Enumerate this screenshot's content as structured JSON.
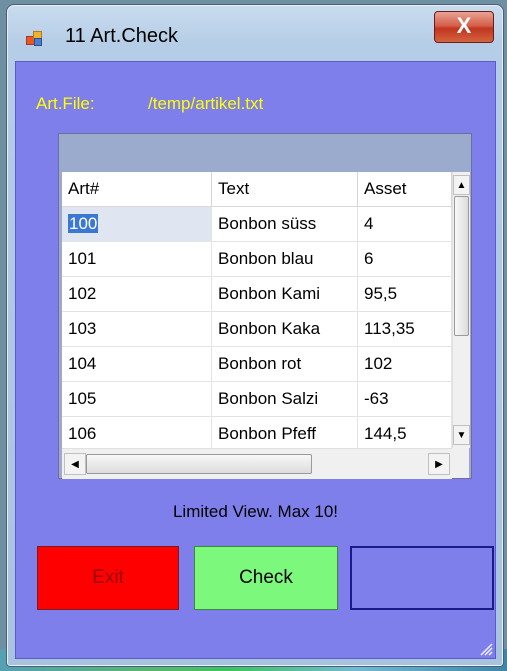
{
  "window": {
    "title": "11 Art.Check",
    "close_glyph": "X"
  },
  "artfile": {
    "label": "Art.File:",
    "path": "/temp/artikel.txt"
  },
  "grid": {
    "columns": [
      "Art#",
      "Text",
      "Asset"
    ],
    "rows": [
      [
        "100",
        "Bonbon süss",
        "4"
      ],
      [
        "101",
        "Bonbon blau",
        "6"
      ],
      [
        "102",
        "Bonbon Kami",
        "95,5"
      ],
      [
        "103",
        "Bonbon Kaka",
        "113,35"
      ],
      [
        "104",
        "Bonbon rot",
        "102"
      ],
      [
        "105",
        "Bonbon Salzi",
        "-63"
      ],
      [
        "106",
        "Bonbon Pfeff",
        "144,5"
      ]
    ],
    "selected_row": 0
  },
  "status": {
    "limit_text": "Limited View. Max 10!"
  },
  "buttons": {
    "exit": "Exit",
    "check": "Check",
    "third": ""
  },
  "colors": {
    "client_bg": "#7f7fec",
    "accent_text": "#ffff00",
    "exit_bg": "#ff0000",
    "check_bg": "#7cf87c"
  },
  "icons": {
    "app": "app-icon",
    "close": "close-icon",
    "scroll_up": "arrow-up-icon",
    "scroll_down": "arrow-down-icon",
    "scroll_left": "arrow-left-icon",
    "scroll_right": "arrow-right-icon",
    "grip": "resize-grip-icon"
  }
}
